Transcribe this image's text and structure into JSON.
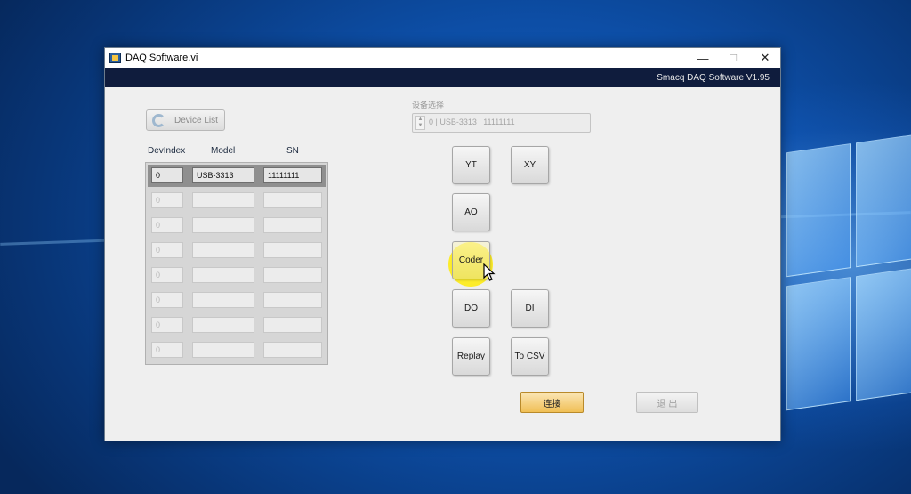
{
  "window": {
    "title": "DAQ Software.vi",
    "minimize_glyph": "—",
    "maximize_glyph": "☐",
    "close_glyph": "✕"
  },
  "banner": {
    "version": "Smacq DAQ Software V1.95"
  },
  "device_list": {
    "button_label": "Device List",
    "icon": "refresh-icon",
    "columns": [
      "DevIndex",
      "Model",
      "SN"
    ],
    "rows": [
      {
        "index": "0",
        "model": "USB-3313",
        "sn": "11111111",
        "selected": true
      },
      {
        "index": "0",
        "model": "",
        "sn": "",
        "selected": false
      },
      {
        "index": "0",
        "model": "",
        "sn": "",
        "selected": false
      },
      {
        "index": "0",
        "model": "",
        "sn": "",
        "selected": false
      },
      {
        "index": "0",
        "model": "",
        "sn": "",
        "selected": false
      },
      {
        "index": "0",
        "model": "",
        "sn": "",
        "selected": false
      },
      {
        "index": "0",
        "model": "",
        "sn": "",
        "selected": false
      },
      {
        "index": "0",
        "model": "",
        "sn": "",
        "selected": false
      }
    ]
  },
  "device_select": {
    "label": "设备选择",
    "value": "0 | USB-3313 | 11111111"
  },
  "functions": {
    "yt": "YT",
    "xy": "XY",
    "ao": "AO",
    "coder": "Coder",
    "do": "DO",
    "di": "DI",
    "replay": "Replay",
    "to_csv": "To CSV"
  },
  "actions": {
    "connect": "连接",
    "exit": "退 出"
  },
  "colors": {
    "banner": "#0f1c3d",
    "connect_accent": "#f0bf55",
    "highlight": "#ffec00"
  }
}
